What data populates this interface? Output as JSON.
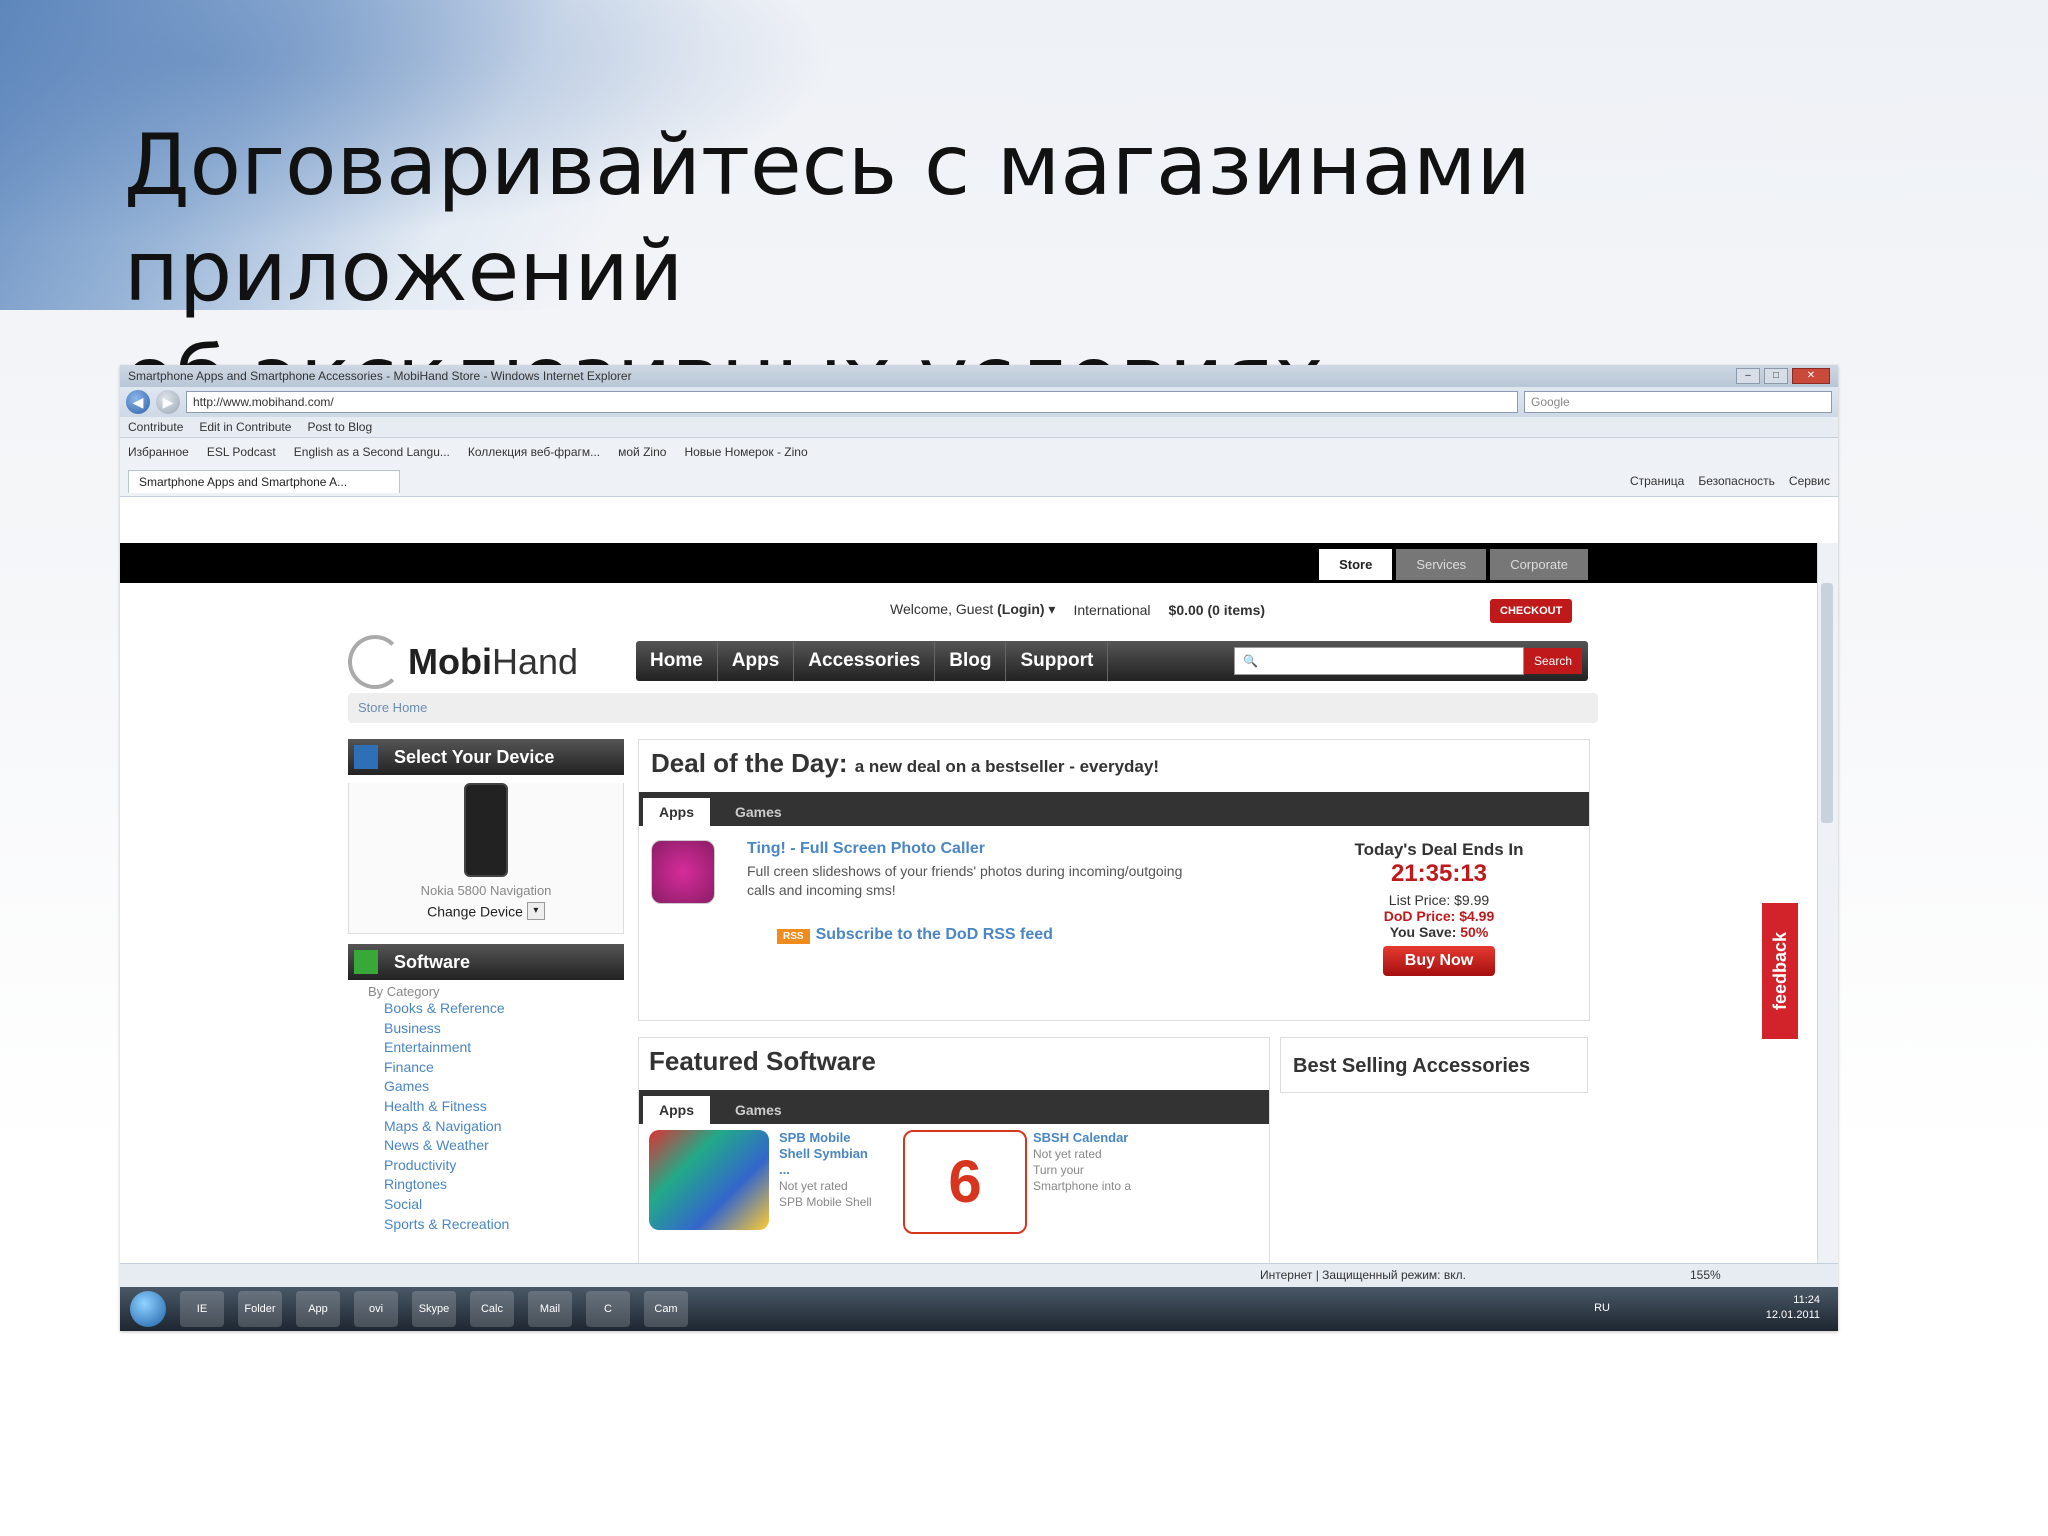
{
  "slide": {
    "title_line1": "Договаривайтесь с магазинами приложений",
    "title_line2": "об эксклюзивных условиях"
  },
  "browser": {
    "window_title": "Smartphone Apps and Smartphone Accessories - MobiHand Store - Windows Internet Explorer",
    "address": "http://www.mobihand.com/",
    "search_placeholder": "Google",
    "toolbar_items": [
      "Contribute",
      "Edit in Contribute",
      "Post to Blog"
    ],
    "favorites": [
      "Избранное",
      "ESL Podcast",
      "English as a Second Langu...",
      "Коллекция веб-фрагм...",
      "мой Zino",
      "Новые Номерок - Zino"
    ],
    "tab_label": "Smartphone Apps and Smartphone A...",
    "command_bar": [
      "Страница",
      "Безопасность",
      "Сервис"
    ],
    "status_zone": "Интернет | Защищенный режим: вкл.",
    "zoom": "155%"
  },
  "site": {
    "top_tabs": [
      "Store",
      "Services",
      "Corporate"
    ],
    "welcome": "Welcome, Guest",
    "login": "(Login)",
    "international": "International",
    "cart": "$0.00 (0 items)",
    "checkout": "CHECKOUT",
    "logo_bold": "Mobi",
    "logo_light": "Hand",
    "nav": [
      "Home",
      "Apps",
      "Accessories",
      "Blog",
      "Support"
    ],
    "search_button": "Search",
    "breadcrumb": "Store Home",
    "select_device": "Select Your Device",
    "device_name": "Nokia 5800 Navigation",
    "change_device": "Change Device",
    "software_heading": "Software",
    "by_category": "By Category",
    "categories": [
      "Books & Reference",
      "Business",
      "Entertainment",
      "Finance",
      "Games",
      "Health & Fitness",
      "Maps & Navigation",
      "News & Weather",
      "Productivity",
      "Ringtones",
      "Social",
      "Sports & Recreation"
    ],
    "dod": {
      "title": "Deal of the Day:",
      "subtitle": "a new deal on a bestseller - everyday!",
      "tabs": [
        "Apps",
        "Games"
      ],
      "app_name": "Ting! - Full Screen Photo Caller",
      "app_desc": "Full creen slideshows of your friends' photos during incoming/outgoing calls and incoming sms!",
      "rss_badge": "RSS",
      "rss_text": "Subscribe to the DoD RSS feed",
      "ends_label": "Today's Deal Ends In",
      "countdown": "21:35:13",
      "list_price": "List Price: $9.99",
      "dod_price": "DoD Price: $4.99",
      "you_save_label": "You Save:",
      "you_save": "50%",
      "buy_now": "Buy Now"
    },
    "featured": {
      "title": "Featured Software",
      "tabs": [
        "Apps",
        "Games"
      ],
      "items": [
        {
          "name": "SPB Mobile Shell Symbian ...",
          "rating": "Not yet rated",
          "desc": "SPB Mobile Shell"
        },
        {
          "name": "SBSH Calendar",
          "rating": "Not yet rated",
          "desc": "Turn your Smartphone into a"
        }
      ],
      "calendar_number": "6"
    },
    "best_selling": "Best Selling Accessories",
    "feedback": "feedback"
  },
  "taskbar": {
    "items": [
      "IE",
      "Folder",
      "App",
      "ovi",
      "Skype",
      "Calc",
      "Mail",
      "C",
      "Cam"
    ],
    "lang": "RU",
    "time": "11:24",
    "date": "12.01.2011"
  }
}
